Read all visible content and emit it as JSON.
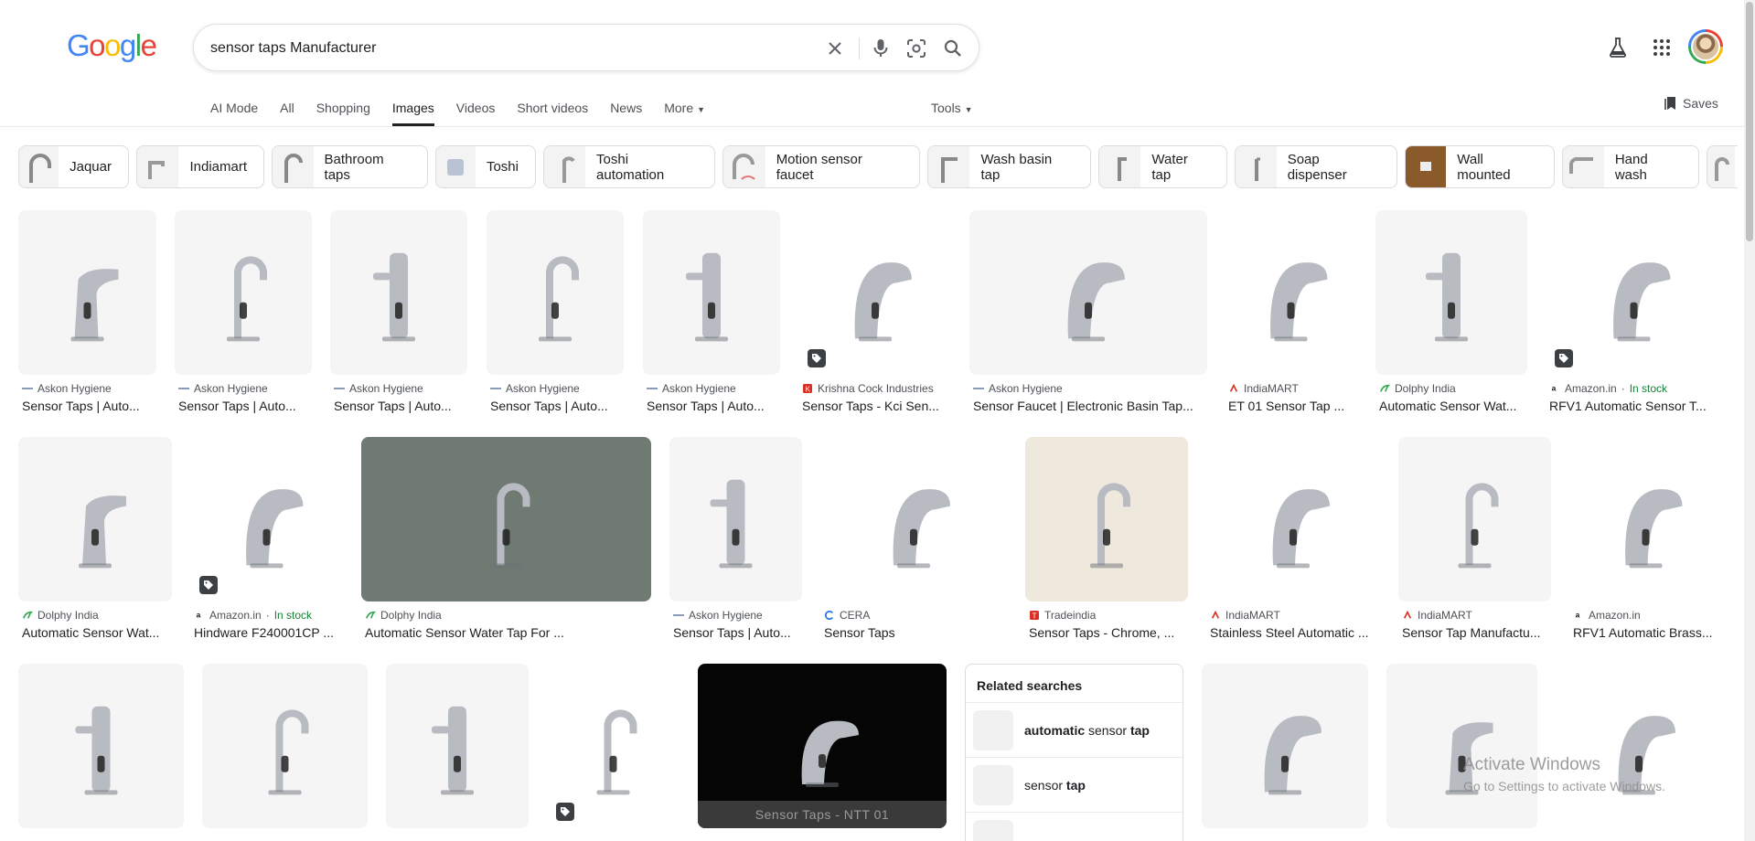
{
  "logo": {
    "text": "Google"
  },
  "search": {
    "value": "sensor taps Manufacturer"
  },
  "header_icons": [
    "clear-icon",
    "mic-icon",
    "lens-icon",
    "search-icon",
    "labs-icon",
    "apps-icon"
  ],
  "tabs": [
    {
      "label": "AI Mode"
    },
    {
      "label": "All"
    },
    {
      "label": "Shopping"
    },
    {
      "label": "Images",
      "active": true
    },
    {
      "label": "Videos"
    },
    {
      "label": "Short videos"
    },
    {
      "label": "News"
    },
    {
      "label": "More"
    }
  ],
  "tools": {
    "label": "Tools"
  },
  "saves": {
    "label": "Saves"
  },
  "chips": [
    {
      "label": "Jaquar"
    },
    {
      "label": "Indiamart"
    },
    {
      "label": "Bathroom taps"
    },
    {
      "label": "Toshi"
    },
    {
      "label": "Toshi automation"
    },
    {
      "label": "Motion sensor faucet"
    },
    {
      "label": "Wash basin tap"
    },
    {
      "label": "Water tap"
    },
    {
      "label": "Soap dispenser"
    },
    {
      "label": "Wall mounted"
    },
    {
      "label": "Hand wash"
    }
  ],
  "results_row1": [
    {
      "source": "Askon Hygiene",
      "title": "Sensor Taps | Auto..."
    },
    {
      "source": "Askon Hygiene",
      "title": "Sensor Taps | Auto..."
    },
    {
      "source": "Askon Hygiene",
      "title": "Sensor Taps | Auto..."
    },
    {
      "source": "Askon Hygiene",
      "title": "Sensor Taps | Auto..."
    },
    {
      "source": "Askon Hygiene",
      "title": "Sensor Taps | Auto..."
    },
    {
      "source": "Krishna Cock Industries",
      "title": "Sensor Taps - Kci Sen..."
    },
    {
      "source": "Askon Hygiene",
      "title": "Sensor Faucet | Electronic Basin Tap..."
    },
    {
      "source": "IndiaMART",
      "title": "ET 01 Sensor Tap ..."
    },
    {
      "source": "Dolphy India",
      "title": "Automatic Sensor Wat..."
    },
    {
      "source": "Amazon.in",
      "stock": "In stock",
      "title": "RFV1 Automatic Sensor T..."
    }
  ],
  "results_row2": [
    {
      "source": "Dolphy India",
      "title": "Automatic Sensor Wat..."
    },
    {
      "source": "Amazon.in",
      "stock": "In stock",
      "title": "Hindware F240001CP ..."
    },
    {
      "source": "Dolphy India",
      "title": "Automatic Sensor Water Tap For ..."
    },
    {
      "source": "Askon Hygiene",
      "title": "Sensor Taps | Auto..."
    },
    {
      "source": "CERA",
      "title": "Sensor Taps"
    },
    {
      "source": "Tradeindia",
      "title": "Sensor Taps - Chrome, ..."
    },
    {
      "source": "IndiaMART",
      "title": "Stainless Steel Automatic ..."
    },
    {
      "source": "IndiaMART",
      "title": "Sensor Tap Manufactu..."
    },
    {
      "source": "Amazon.in",
      "title": "RFV1 Automatic Brass..."
    }
  ],
  "row3_overlay": {
    "caption": "Sensor Taps - NTT 01"
  },
  "related_searches": {
    "heading": "Related searches",
    "items": [
      {
        "bold_a": "automatic",
        "plain": " sensor ",
        "bold_b": "tap"
      },
      {
        "bold_a": "",
        "plain": "sensor ",
        "bold_b": "tap"
      }
    ]
  },
  "watermark": {
    "line1": "Activate Windows",
    "line2": "Go to Settings to activate Windows."
  },
  "colors": {
    "accent_blue": "#4285f4",
    "in_stock_green": "#188038",
    "text": "#202124",
    "muted": "#4d5156"
  }
}
